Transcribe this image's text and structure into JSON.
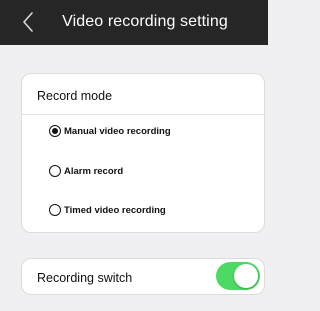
{
  "header": {
    "title": "Video recording setting",
    "back_icon": "chevron-left-icon"
  },
  "record_mode": {
    "title": "Record mode",
    "options": [
      {
        "label": "Manual video recording",
        "selected": true
      },
      {
        "label": "Alarm record",
        "selected": false
      },
      {
        "label": "Timed video recording",
        "selected": false
      }
    ]
  },
  "recording_switch": {
    "label": "Recording switch",
    "on": true,
    "on_color": "#4cd964"
  },
  "colors": {
    "header_bg": "#262626",
    "page_bg": "#f0f0f2",
    "card_bg": "#ffffff"
  }
}
